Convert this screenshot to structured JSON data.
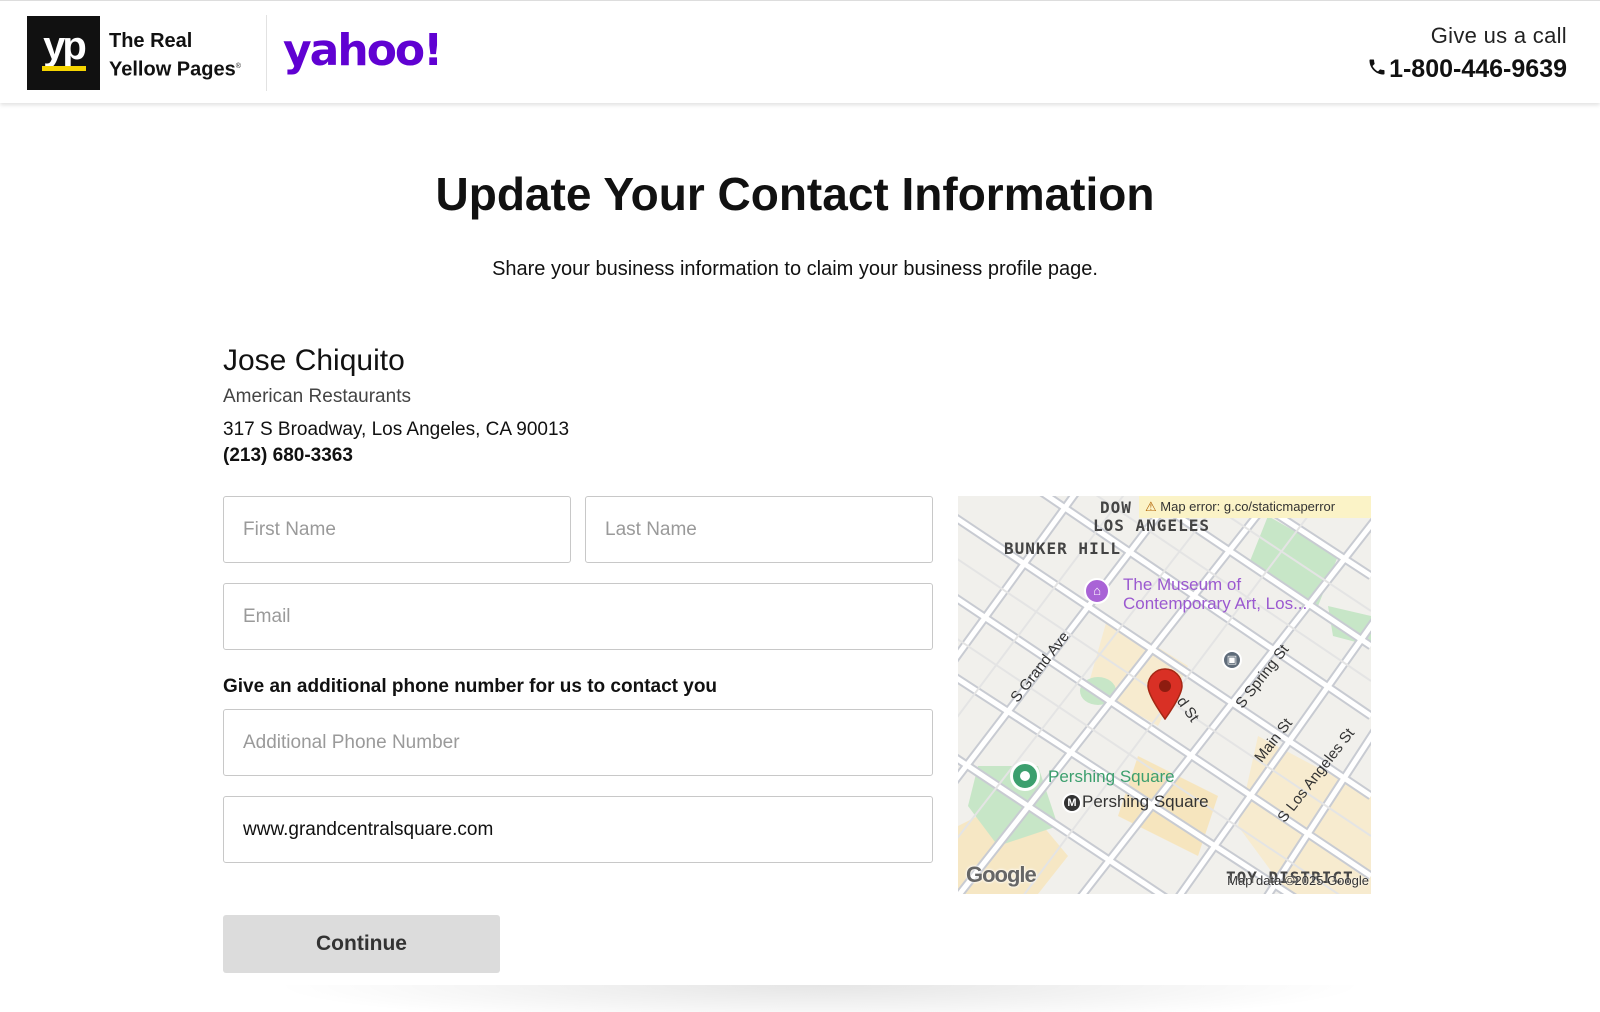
{
  "header": {
    "logo_mark": "yp",
    "logo_line1": "The Real",
    "logo_line2": "Yellow Pages",
    "logo_trademark": "®",
    "partner_logo": "yahoo!",
    "call_label": "Give us a call",
    "call_phone": "1-800-446-9639",
    "phone_icon": "phone-icon",
    "brand_color": "#6001d2"
  },
  "main": {
    "title": "Update Your Contact Information",
    "subtitle": "Share your business information to claim your business profile page."
  },
  "business": {
    "name": "Jose Chiquito",
    "category": "American Restaurants",
    "address": "317 S Broadway, Los Angeles, CA 90013",
    "phone": "(213) 680-3363"
  },
  "form": {
    "first_name": {
      "placeholder": "First Name",
      "value": ""
    },
    "last_name": {
      "placeholder": "Last Name",
      "value": ""
    },
    "email": {
      "placeholder": "Email",
      "value": ""
    },
    "phone_label": "Give an additional phone number for us to contact you",
    "additional_phone": {
      "placeholder": "Additional Phone Number",
      "value": ""
    },
    "website": {
      "value": "www.grandcentralsquare.com"
    },
    "continue_label": "Continue"
  },
  "map": {
    "error_text": "Map error: g.co/staticmaperror",
    "area_labels": [
      "DOW",
      "LOS ANGELES",
      "BUNKER HILL",
      "TOY DISTRICT"
    ],
    "poi_museum_line1": "The Museum of",
    "poi_museum_line2": "Contemporary Art, Los...",
    "poi_park": "Pershing Square",
    "poi_metro": "Pershing Square",
    "streets": [
      "S Grand Ave",
      "d St",
      "S Spring St",
      "Main St",
      "S Los Angeles St"
    ],
    "logo": "Google",
    "attribution": "Map data ©2025 Google",
    "marker_color": "#d93025"
  }
}
